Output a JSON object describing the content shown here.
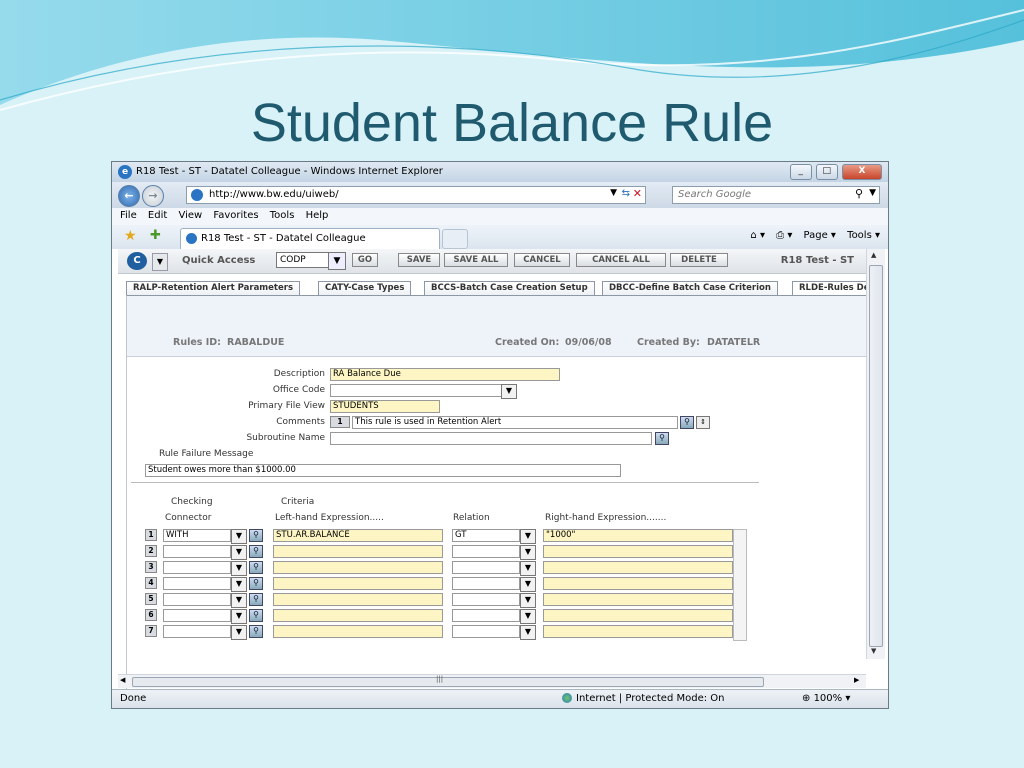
{
  "slide": {
    "title": "Student Balance Rule"
  },
  "window": {
    "title": "R18 Test - ST - Datatel Colleague - Windows Internet Explorer",
    "min": "_",
    "max": "□",
    "close": "X"
  },
  "address": {
    "url": "http://www.bw.edu/uiweb/",
    "search_placeholder": "Search Google"
  },
  "menu": [
    "File",
    "Edit",
    "View",
    "Favorites",
    "Tools",
    "Help"
  ],
  "browser_tab": {
    "label": "R18 Test - ST - Datatel Colleague"
  },
  "command_bar": {
    "page": "Page ▾",
    "tools": "Tools ▾"
  },
  "app_toolbar": {
    "quick_access_label": "Quick Access",
    "quick_access_value": "CODP",
    "go": "GO",
    "save": "SAVE",
    "save_all": "SAVE ALL",
    "cancel": "CANCEL",
    "cancel_all": "CANCEL ALL",
    "delete": "DELETE",
    "title": "R18 Test - ST"
  },
  "form_tabs": [
    "RALP-Retention Alert Parameters",
    "CATY-Case Types",
    "BCCS-Batch Case Creation Setup",
    "DBCC-Define Batch Case Criterion",
    "RLDE-Rules De"
  ],
  "header": {
    "rules_id_label": "Rules ID:",
    "rules_id": "RABALDUE",
    "created_on_label": "Created On:",
    "created_on": "09/06/08",
    "created_by_label": "Created By:",
    "created_by": "DATATELR"
  },
  "fields": {
    "description_label": "Description",
    "description": "RA Balance Due",
    "office_code_label": "Office Code",
    "office_code": "",
    "primary_file_view_label": "Primary File View",
    "primary_file_view": "STUDENTS",
    "comments_label": "Comments",
    "comments_seq": "1",
    "comments": "This rule is used in Retention Alert",
    "subroutine_name_label": "Subroutine Name",
    "subroutine_name": "",
    "rule_failure_label": "Rule Failure Message",
    "rule_failure": "Student owes more than $1000.00"
  },
  "criteria": {
    "checking_label": "Checking",
    "criteria_label": "Criteria",
    "connector_label": "Connector",
    "lhs_label": "Left-hand Expression.....",
    "relation_label": "Relation",
    "rhs_label": "Right-hand Expression.......",
    "rows": [
      {
        "seq": "1",
        "connector": "WITH",
        "lhs": "STU.AR.BALANCE",
        "relation": "GT",
        "rhs": "\"1000\""
      },
      {
        "seq": "2",
        "connector": "",
        "lhs": "",
        "relation": "",
        "rhs": ""
      },
      {
        "seq": "3",
        "connector": "",
        "lhs": "",
        "relation": "",
        "rhs": ""
      },
      {
        "seq": "4",
        "connector": "",
        "lhs": "",
        "relation": "",
        "rhs": ""
      },
      {
        "seq": "5",
        "connector": "",
        "lhs": "",
        "relation": "",
        "rhs": ""
      },
      {
        "seq": "6",
        "connector": "",
        "lhs": "",
        "relation": "",
        "rhs": ""
      },
      {
        "seq": "7",
        "connector": "",
        "lhs": "",
        "relation": "",
        "rhs": ""
      }
    ]
  },
  "status": {
    "done": "Done",
    "zone": "Internet | Protected Mode: On",
    "zoom": "100%"
  },
  "colors": {
    "title": "#1f5a6e",
    "field_yellow": "#fdf6c4",
    "header_band": "#eef3fa"
  }
}
